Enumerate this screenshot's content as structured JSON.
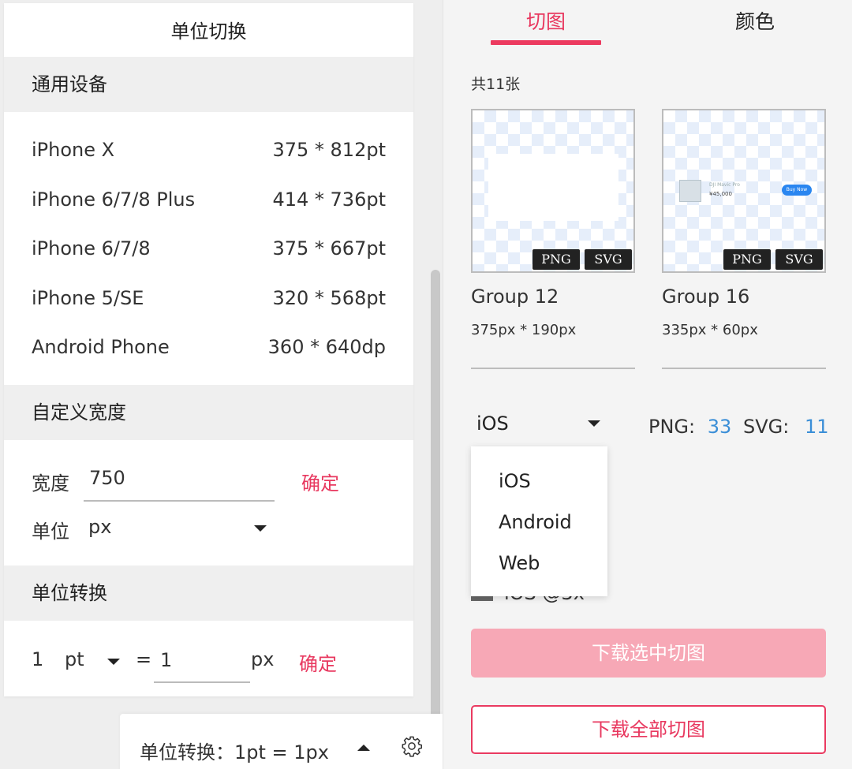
{
  "left": {
    "title": "单位切换",
    "section_devices": "通用设备",
    "devices": [
      {
        "name": "iPhone X",
        "size": "375 * 812pt"
      },
      {
        "name": "iPhone 6/7/8 Plus",
        "size": "414 * 736pt"
      },
      {
        "name": "iPhone 6/7/8",
        "size": "375 * 667pt"
      },
      {
        "name": "iPhone 5/SE",
        "size": "320 * 568pt"
      },
      {
        "name": "Android Phone",
        "size": "360 * 640dp"
      }
    ],
    "section_custom": "自定义宽度",
    "width_label": "宽度",
    "width_value": "750",
    "confirm": "确定",
    "unit_label": "单位",
    "unit_value": "px",
    "section_convert": "单位转换",
    "convert_left_value": "1",
    "convert_left_unit": "pt",
    "convert_eq": "=",
    "convert_right_value": "1",
    "convert_right_unit": "px",
    "convert_confirm": "确定"
  },
  "status": {
    "text": "单位转换：1pt = 1px"
  },
  "right": {
    "tabs": [
      "切图",
      "颜色"
    ],
    "count": "共11张",
    "slices": [
      {
        "name": "Group 12",
        "size": "375px * 190px"
      },
      {
        "name": "Group 16",
        "size": "335px * 60px"
      }
    ],
    "badge_png": "PNG",
    "badge_svg": "SVG",
    "mini_card": {
      "name": "DJI Mavic Pro",
      "price": "¥45,000",
      "button": "Buy Now"
    },
    "platform_selected": "iOS",
    "png_label": "PNG:",
    "png_count": "33",
    "svg_label": "SVG:",
    "svg_count": "11",
    "platform_options": [
      "iOS",
      "Android",
      "Web"
    ],
    "hidden_option_text": "iOS @3x",
    "download_selected": "下载选中切图",
    "download_all": "下载全部切图"
  },
  "colors": {
    "accent": "#e8385f",
    "accent_light": "#f7a8b6",
    "link_blue": "#3a8ed7"
  },
  "icons": {
    "platform_caret": "chevron-down-icon",
    "status_caret": "chevron-up-icon",
    "settings": "gear-icon"
  }
}
